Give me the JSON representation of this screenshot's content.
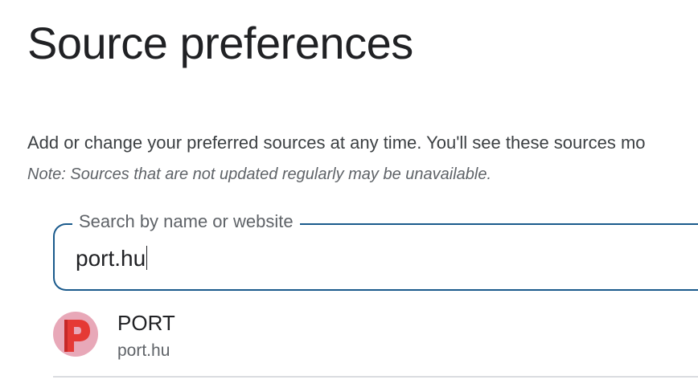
{
  "page": {
    "title": "Source preferences",
    "description": "Add or change your preferred sources at any time. You'll see these sources mo",
    "note": "Note: Sources that are not updated regularly may be unavailable."
  },
  "search": {
    "label": "Search by name or website",
    "value": "port.hu"
  },
  "results": [
    {
      "name": "PORT",
      "url": "port.hu",
      "logo_letter": "P",
      "logo_color": "#e53935",
      "logo_bg": "#e8a8b8"
    }
  ],
  "colors": {
    "accent": "#1a5a8c",
    "divider": "#dadce0"
  }
}
